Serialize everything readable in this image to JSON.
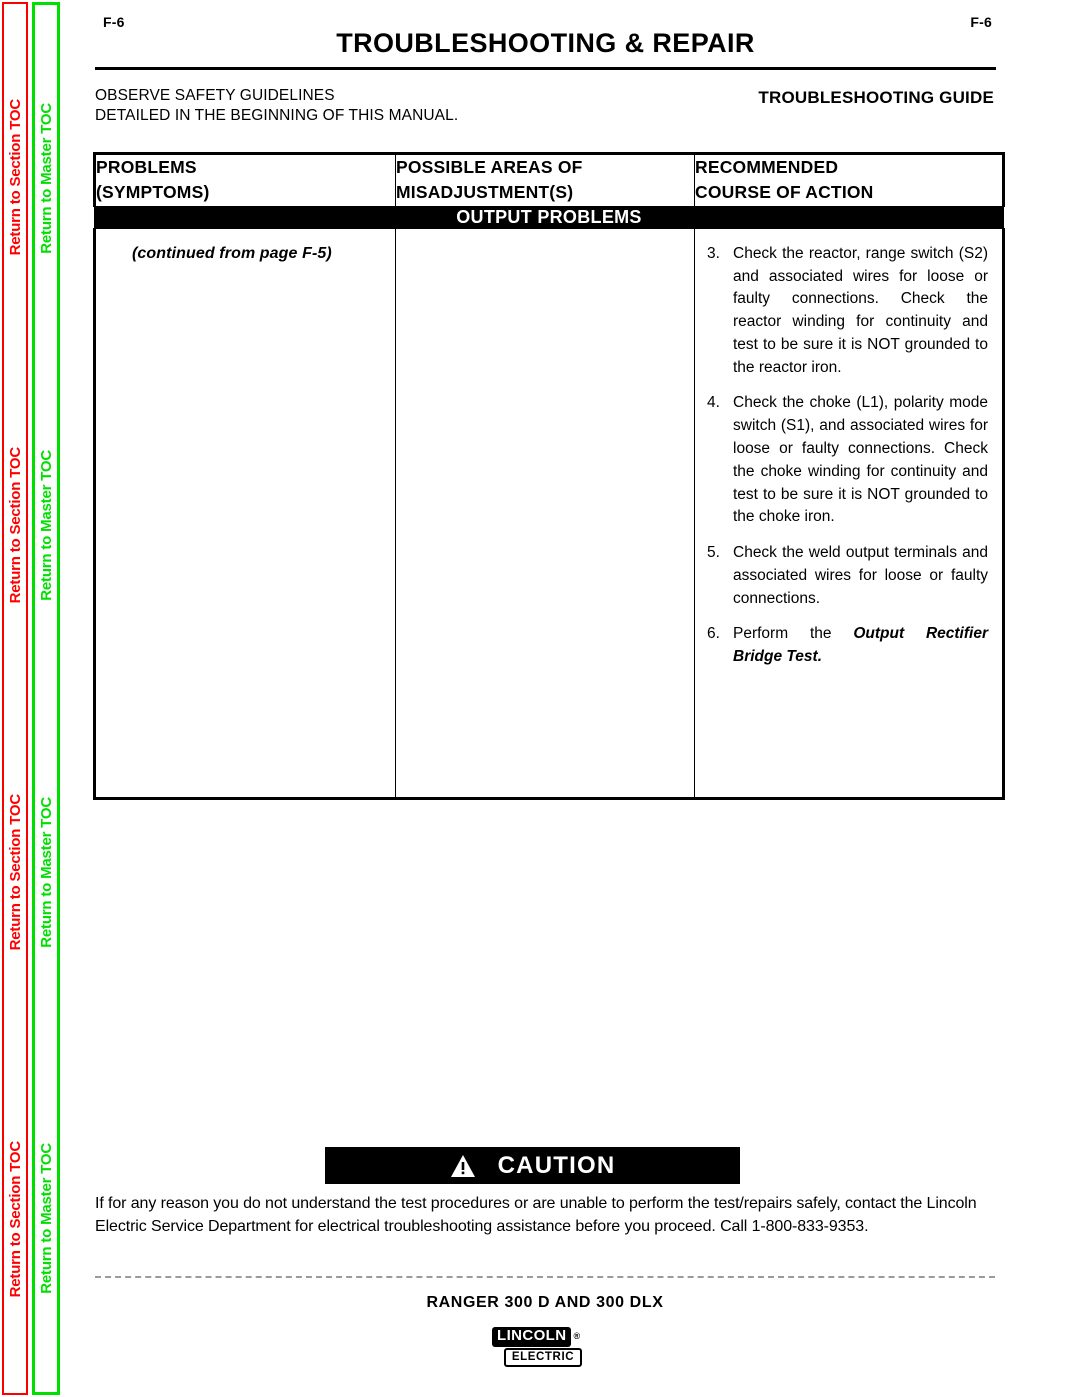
{
  "sidebar": {
    "section_toc_label": "Return to Section TOC",
    "master_toc_label": "Return to Master TOC",
    "section_color": "#ff0000",
    "master_color": "#00e000",
    "repeat_count": 4
  },
  "header": {
    "folio_left": "F-6",
    "folio_right": "F-6",
    "title": "TROUBLESHOOTING & REPAIR",
    "safety_line_1": "OBSERVE SAFETY GUIDELINES",
    "safety_line_2": "DETAILED IN THE BEGINNING OF THIS MANUAL.",
    "guide_label": "TROUBLESHOOTING GUIDE"
  },
  "table": {
    "columns": [
      {
        "line1": "PROBLEMS",
        "line2": "(SYMPTOMS)"
      },
      {
        "line1": "POSSIBLE AREAS OF",
        "line2": "MISADJUSTMENT(S)"
      },
      {
        "line1": "RECOMMENDED",
        "line2": "COURSE OF ACTION"
      }
    ],
    "section_band": "OUTPUT PROBLEMS",
    "problem_cell": "(continued from page F-5)",
    "misadjustment_cell": "",
    "actions": [
      {
        "number": "3.",
        "text": "Check the reactor, range switch (S2) and associated wires for loose or faulty connections. Check the reactor winding for continuity and test to be sure it is NOT grounded to the reactor iron.",
        "bold_tail": ""
      },
      {
        "number": "4.",
        "text": "Check the choke (L1), polarity mode switch (S1), and associated wires for loose or faulty connections.  Check the choke winding for continuity and test to be sure it is NOT grounded to the choke iron.",
        "bold_tail": ""
      },
      {
        "number": "5.",
        "text": "Check the weld output terminals and associated wires for loose or faulty connections.",
        "bold_tail": ""
      },
      {
        "number": "6.",
        "text": "Perform the ",
        "bold_tail": "Output Rectifier Bridge Test."
      }
    ]
  },
  "caution": {
    "icon": "warning-triangle-icon",
    "word": "CAUTION",
    "body": "If for any reason you do not understand the test procedures or are unable to perform the test/repairs safely, contact the Lincoln Electric Service Department for electrical troubleshooting assistance before you proceed.  Call 1-800-833-9353."
  },
  "footer": {
    "model": "RANGER 300 D AND 300 DLX",
    "logo_primary": "LINCOLN",
    "logo_registered": "®",
    "logo_secondary": "ELECTRIC"
  }
}
